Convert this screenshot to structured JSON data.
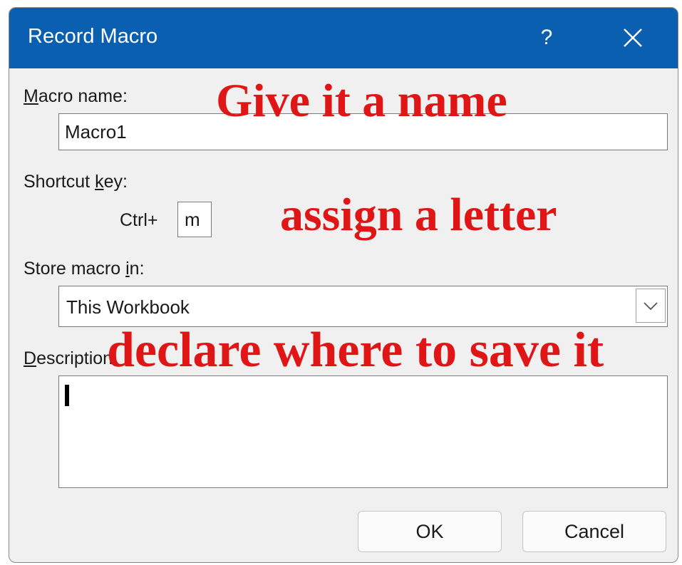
{
  "dialog": {
    "title": "Record Macro",
    "help_label": "?",
    "close_label": "✕"
  },
  "macro_name": {
    "label_prefix": "M",
    "label_rest": "acro name:",
    "value": "Macro1"
  },
  "shortcut": {
    "label_prefix": "Shortcut ",
    "label_ul": "k",
    "label_rest": "ey:",
    "ctrl_label": "Ctrl+",
    "value": "m"
  },
  "store": {
    "label_prefix": "Store macro ",
    "label_ul": "i",
    "label_rest": "n:",
    "selected": "This Workbook"
  },
  "description": {
    "label_prefix": "D",
    "label_rest": "escription:",
    "value": ""
  },
  "buttons": {
    "ok": "OK",
    "cancel": "Cancel"
  },
  "annotations": {
    "name": "Give it a name",
    "letter": "assign a letter",
    "save": "declare where to save it"
  },
  "colors": {
    "titlebar": "#0a5fb0",
    "annotation": "#e01616",
    "dialog_bg": "#f0f0f0"
  }
}
